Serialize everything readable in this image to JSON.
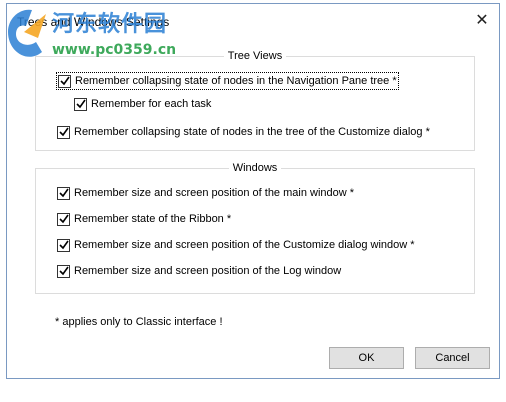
{
  "dialog": {
    "title": "Trees and Windows Settings",
    "close_icon": "close-icon"
  },
  "watermark": {
    "chinese_text": "河东软件园",
    "url_text": "www.pc0359.cn"
  },
  "tree_views": {
    "legend": "Tree  Views",
    "options": [
      {
        "label": "Remember collapsing state of nodes in the Navigation Pane tree *",
        "checked": true
      },
      {
        "label": "Remember for each task",
        "checked": true
      },
      {
        "label": "Remember collapsing state of nodes in the tree of the Customize dialog *",
        "checked": true
      }
    ]
  },
  "windows": {
    "legend": "Windows",
    "options": [
      {
        "label": "Remember size and screen position of the main window *",
        "checked": true
      },
      {
        "label": "Remember state of the Ribbon *",
        "checked": true
      },
      {
        "label": "Remember size and screen position of the Customize dialog window *",
        "checked": true
      },
      {
        "label": "Remember size and screen position of the Log window",
        "checked": true
      }
    ]
  },
  "note": "* applies only to Classic interface !",
  "buttons": {
    "ok": "OK",
    "cancel": "Cancel"
  },
  "colors": {
    "border": "#7a99c2",
    "button_bg": "#e1e1e1",
    "watermark_blue": "#2a7fd4",
    "watermark_green": "#2aa04a"
  }
}
